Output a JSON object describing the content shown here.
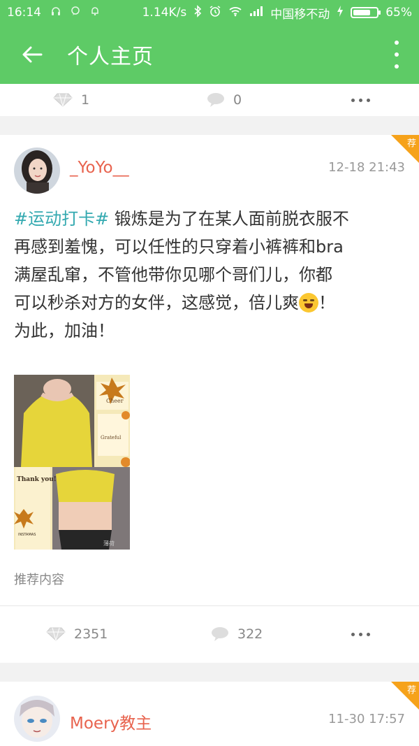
{
  "status_bar": {
    "time": "16:14",
    "speed": "1.14K/s",
    "carrier": "中国移不动",
    "battery": "65%",
    "battery_level": 0.65
  },
  "app_bar": {
    "title": "个人主页"
  },
  "prev_post": {
    "likes": "1",
    "comments": "0"
  },
  "post1": {
    "username": "_YoYo__",
    "time": "12-18 21:43",
    "badge": "荐",
    "tag": "#运动打卡#",
    "line1": " 锻炼是为了在某人面前脱衣服不",
    "line2": "再感到羞愧，可以任性的只穿着小裤裤和bra",
    "line3": "满屋乱窜，不管他带你见哪个哥们儿，你都",
    "line4a": "可以秒杀对方的女伴，这感觉，倍儿爽",
    "line4b": "！",
    "line5": "为此，加油！",
    "image_text_top": "Cheer",
    "image_text_mid": "Grateful",
    "image_text_thank": "Thank you!",
    "image_text_bottom": "INSTAMAS",
    "image_watermark": "薄荷",
    "recommend_label": "推荐内容",
    "likes": "2351",
    "comments": "322"
  },
  "post2": {
    "username": "Moery教主",
    "time": "11-30 17:57",
    "badge": "荐"
  },
  "colors": {
    "brand_green": "#5ecb66",
    "username": "#e8634e",
    "tag": "#33a9b0",
    "badge": "#f6a21a"
  },
  "icons": [
    "back-arrow-icon",
    "more-vertical-icon",
    "diamond-like-icon",
    "comment-bubble-icon",
    "more-horizontal-icon"
  ]
}
